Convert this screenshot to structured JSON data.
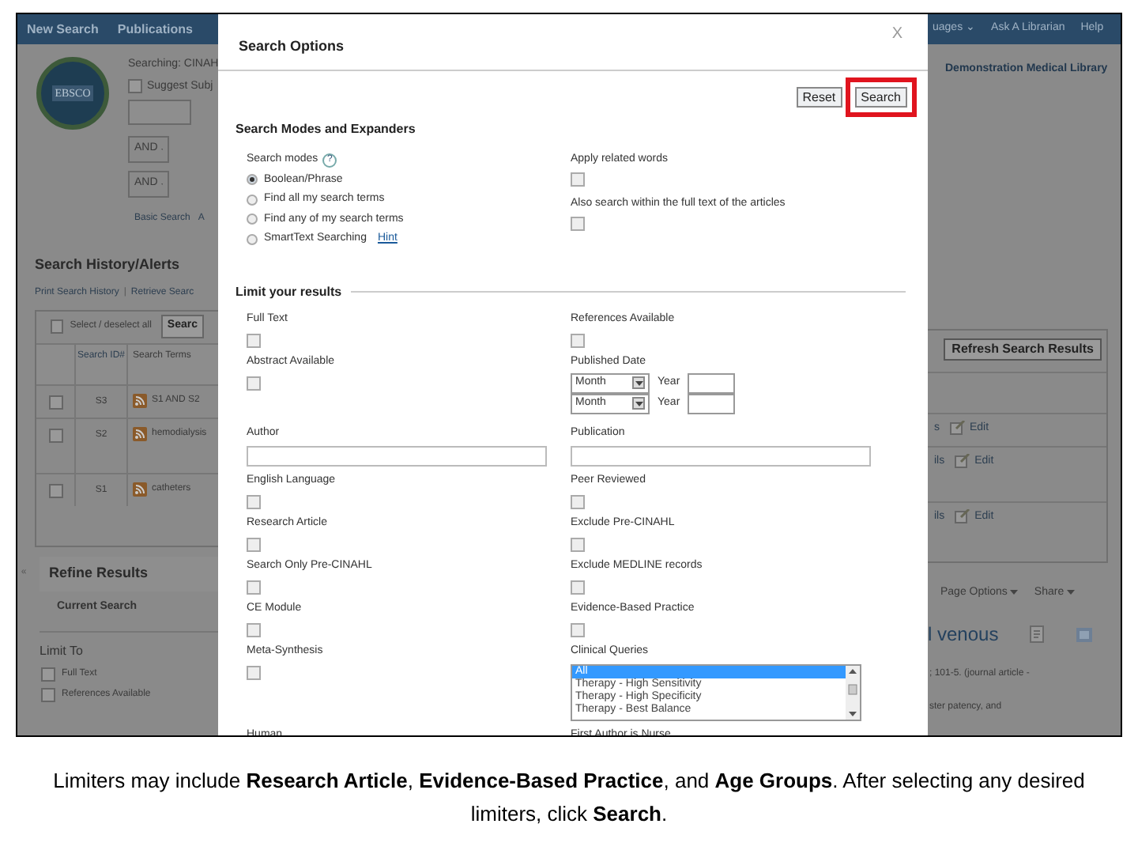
{
  "background_page": {
    "nav_left": [
      "New Search",
      "Publications"
    ],
    "nav_right": [
      "uages ⌄",
      "Ask A Librarian",
      "Help"
    ],
    "logo_text": "EBSCO",
    "searching": "Searching: CINAH",
    "suggest": {
      "label": "Suggest Subj",
      "checked": false
    },
    "operators": [
      "AND",
      "AND"
    ],
    "search_links": [
      "Basic Search",
      "A"
    ],
    "library": "Demonstration Medical Library",
    "history": {
      "title": "Search History/Alerts",
      "links": [
        "Print Search History",
        "Retrieve Searc"
      ],
      "separator": "|",
      "select_all": {
        "label": "Select / deselect all",
        "checked": false
      },
      "search_button": "Searc",
      "refresh_button": "Refresh Search Results",
      "columns": [
        "Search ID#",
        "Search Terms"
      ],
      "rows": [
        {
          "id": "S3",
          "terms": "S1 AND S2",
          "fragment": "s",
          "edit": "Edit",
          "checked": false
        },
        {
          "id": "S2",
          "terms": "hemodialysis",
          "fragment": "ils",
          "edit": "Edit",
          "checked": false
        },
        {
          "id": "S1",
          "terms": "catheters",
          "fragment": "ils",
          "edit": "Edit",
          "checked": false
        }
      ]
    },
    "refine": {
      "collapse": "«",
      "title": "Refine Results",
      "current": "Current Search",
      "limit_to": "Limit To",
      "limits": [
        {
          "label": "Full Text",
          "checked": false
        },
        {
          "label": "References Available",
          "checked": false
        }
      ]
    },
    "results": {
      "page_options": "Page Options",
      "share": "Share",
      "title_fragment": "l venous",
      "lines": [
        "; 101-5. (journal article -",
        "ster patency, and"
      ]
    }
  },
  "dialog": {
    "title": "Search Options",
    "close": "X",
    "buttons": [
      {
        "label": "Reset",
        "highlighted": false
      },
      {
        "label": "Search",
        "highlighted": true
      }
    ],
    "modes_heading": "Search Modes and Expanders",
    "modes_label": "Search modes",
    "help": "?",
    "modes": [
      {
        "label": "Boolean/Phrase",
        "selected": true
      },
      {
        "label": "Find all my search terms",
        "selected": false
      },
      {
        "label": "Find any of my search terms",
        "selected": false
      },
      {
        "label": "SmartText Searching",
        "selected": false,
        "link": "Hint"
      }
    ],
    "expanders": [
      {
        "label": "Apply related words",
        "checked": false
      },
      {
        "label": "Also search within the full text of the articles",
        "checked": false
      }
    ],
    "limits_heading": "Limit your results",
    "limiters": [
      {
        "kind": "checkbox",
        "label": "Full Text",
        "checked": false
      },
      {
        "kind": "checkbox",
        "label": "References Available",
        "checked": false
      },
      {
        "kind": "checkbox",
        "label": "Abstract Available",
        "checked": false
      },
      {
        "kind": "date",
        "label": "Published Date",
        "rows": [
          {
            "month": "Month",
            "year": "Year"
          },
          {
            "month": "Month",
            "year": "Year"
          }
        ]
      },
      {
        "kind": "text",
        "label": "Author"
      },
      {
        "kind": "text",
        "label": "Publication"
      },
      {
        "kind": "checkbox",
        "label": "English Language",
        "checked": false
      },
      {
        "kind": "checkbox",
        "label": "Peer Reviewed",
        "checked": false
      },
      {
        "kind": "checkbox",
        "label": "Research Article",
        "checked": false
      },
      {
        "kind": "checkbox",
        "label": "Exclude Pre-CINAHL",
        "checked": false
      },
      {
        "kind": "checkbox",
        "label": "Search Only Pre-CINAHL",
        "checked": false
      },
      {
        "kind": "checkbox",
        "label": "Exclude MEDLINE records",
        "checked": false
      },
      {
        "kind": "checkbox",
        "label": "CE Module",
        "checked": false
      },
      {
        "kind": "checkbox",
        "label": "Evidence-Based Practice",
        "checked": false
      },
      {
        "kind": "checkbox",
        "label": "Meta-Synthesis",
        "checked": false
      },
      {
        "kind": "listbox",
        "label": "Clinical Queries",
        "options": [
          {
            "label": "All",
            "selected": true
          },
          {
            "label": "Therapy - High Sensitivity",
            "selected": false
          },
          {
            "label": "Therapy - High Specificity",
            "selected": false
          },
          {
            "label": "Therapy - Best Balance",
            "selected": false
          }
        ]
      },
      {
        "kind": "heading",
        "label": "Human"
      },
      {
        "kind": "heading",
        "label": "First Author is Nurse"
      }
    ]
  },
  "caption": "Limiters may include **Research Article**, **Evidence-Based Practice**, and **Age Groups**. After selecting any desired limiters, click **Search**."
}
